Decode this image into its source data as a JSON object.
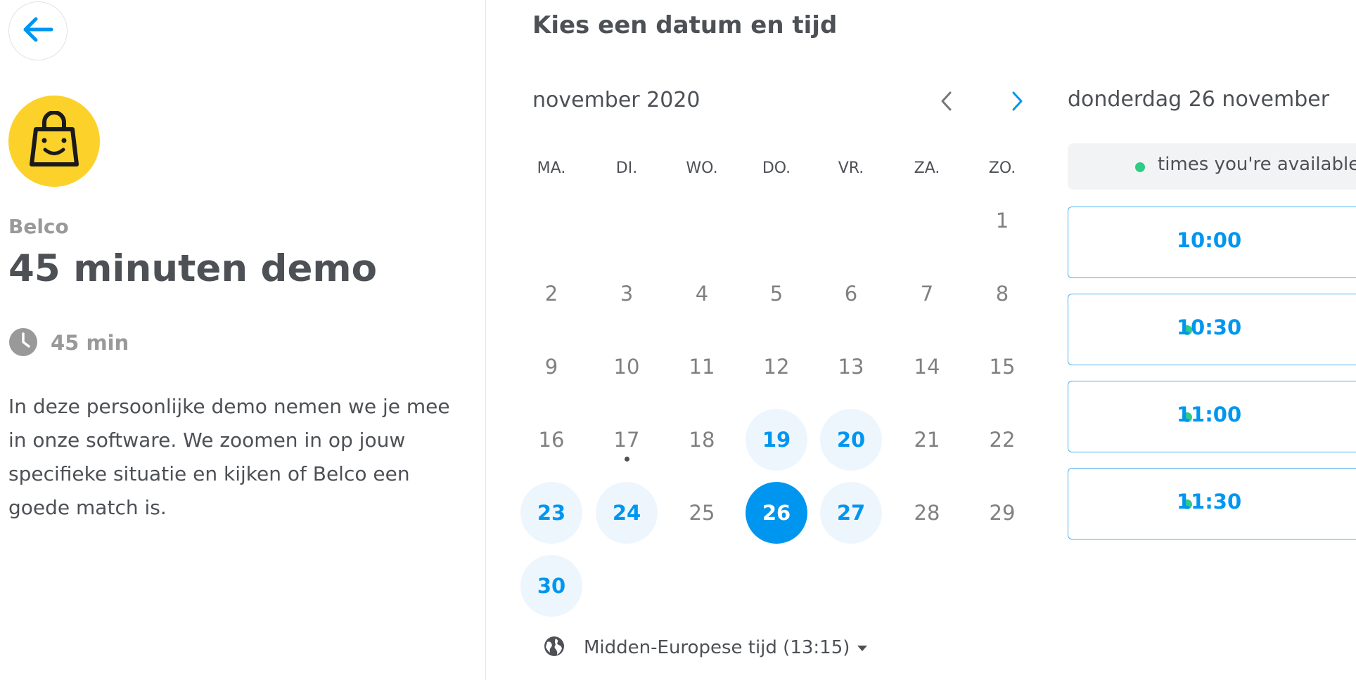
{
  "event": {
    "company": "Belco",
    "title": "45 minuten demo",
    "duration": "45 min",
    "description": "In deze persoonlijke demo nemen we je mee in onze software. We zoomen in op jouw specifieke situatie en kijken of Belco een goede match is."
  },
  "calendar": {
    "heading": "Kies een datum en tijd",
    "month_label": "november 2020",
    "weekdays": [
      "MA.",
      "DI.",
      "WO.",
      "DO.",
      "VR.",
      "ZA.",
      "ZO."
    ],
    "today": "17",
    "selected": "26",
    "weeks": [
      [
        "",
        "",
        "",
        "",
        "",
        "",
        "1"
      ],
      [
        "2",
        "3",
        "4",
        "5",
        "6",
        "7",
        "8"
      ],
      [
        "9",
        "10",
        "11",
        "12",
        "13",
        "14",
        "15"
      ],
      [
        "16",
        "17",
        "18",
        "19",
        "20",
        "21",
        "22"
      ],
      [
        "23",
        "24",
        "25",
        "26",
        "27",
        "28",
        "29"
      ],
      [
        "30",
        "",
        "",
        "",
        "",
        "",
        ""
      ]
    ],
    "available_days": [
      "19",
      "20",
      "23",
      "24",
      "26",
      "27",
      "30"
    ],
    "timezone": "Midden-Europese tijd (13:15)"
  },
  "times": {
    "date_heading": "donderdag 26 november",
    "legend": "times you're available",
    "slots": [
      {
        "time": "10:00",
        "dot": false
      },
      {
        "time": "10:30",
        "dot": true
      },
      {
        "time": "11:00",
        "dot": true
      },
      {
        "time": "11:30",
        "dot": true
      }
    ]
  },
  "colors": {
    "accent": "#0096f0",
    "available_bg": "#eef6fd",
    "available_dot": "#2ecc85",
    "logo": "#fcd12a"
  }
}
